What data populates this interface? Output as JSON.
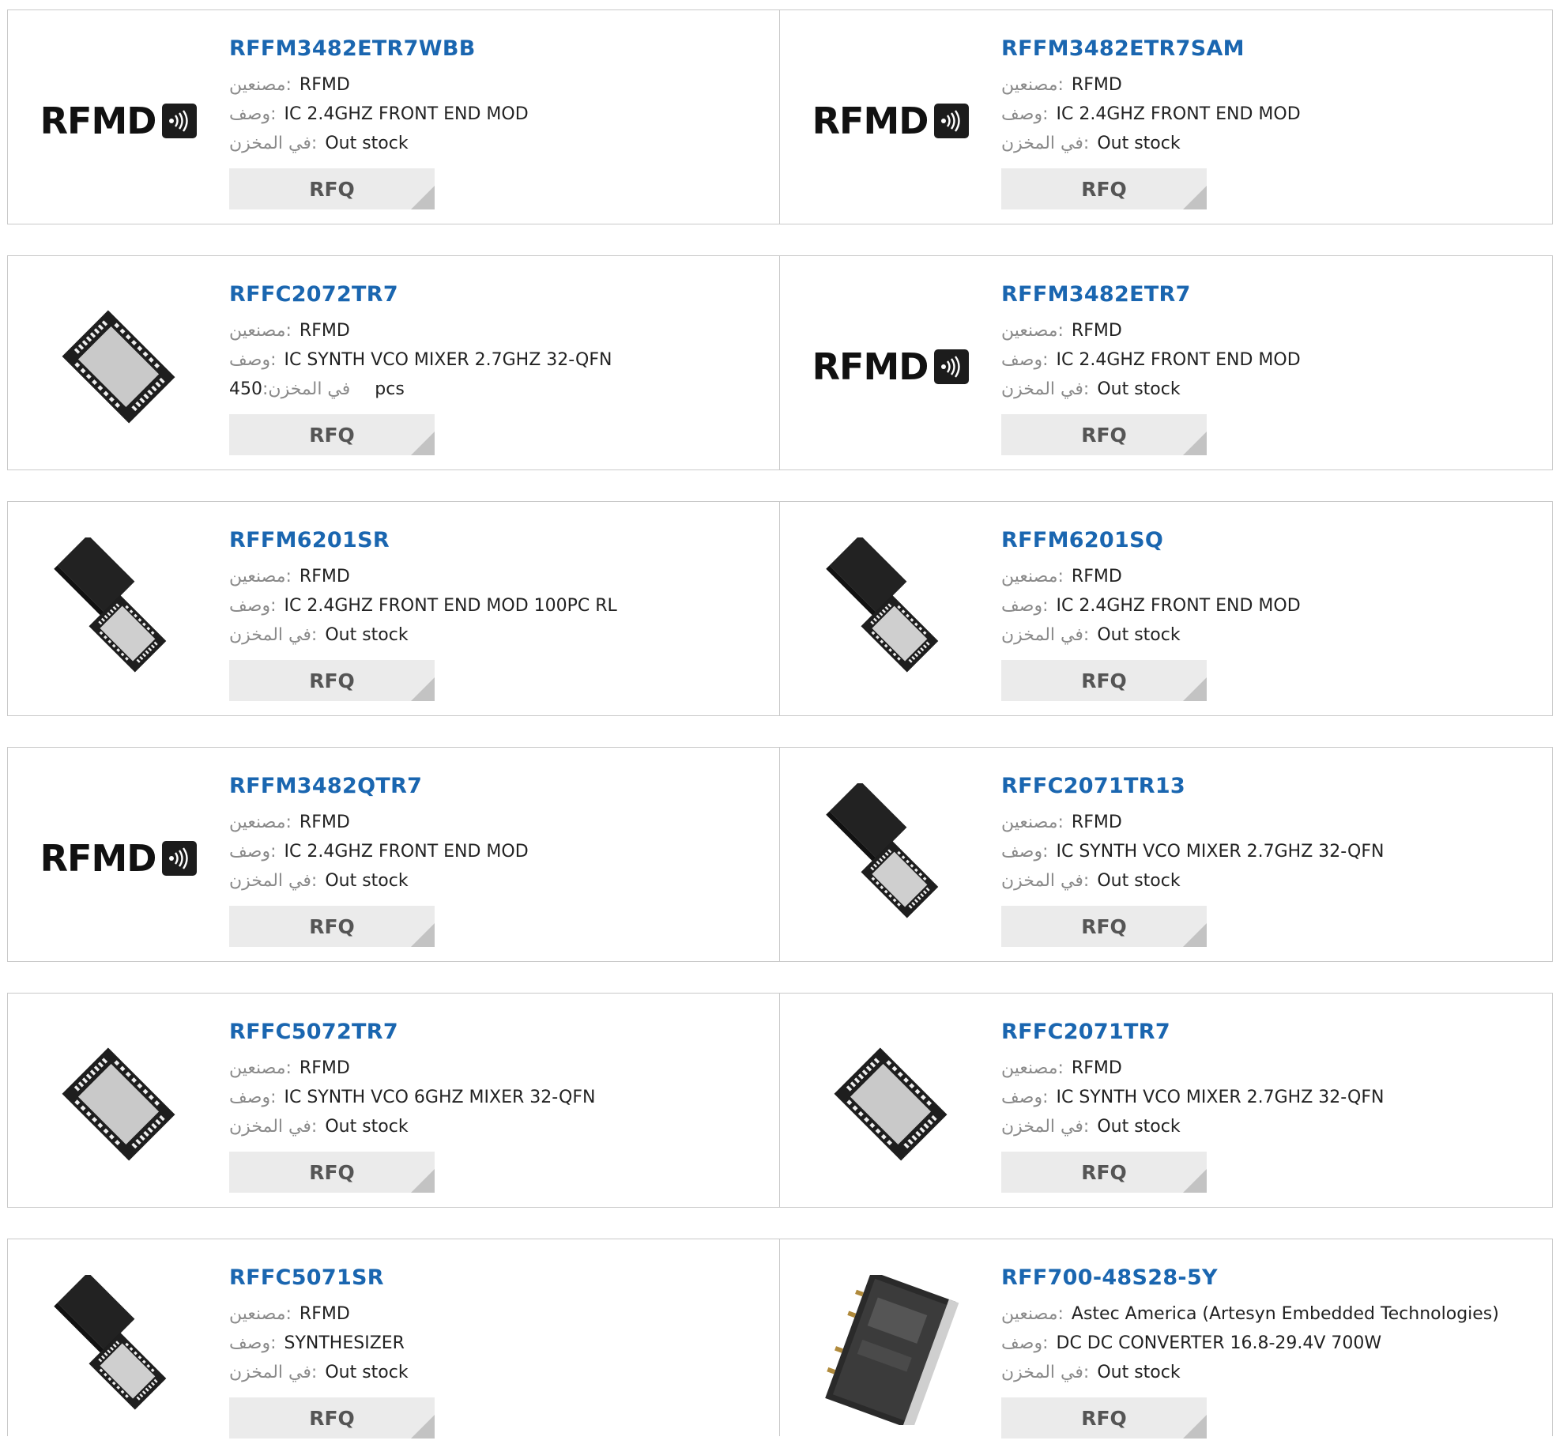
{
  "labels": {
    "manufacturer": "مصنعين:",
    "description": "وصف:",
    "in_stock": "في المخزن:",
    "rfq": "RFQ"
  },
  "colors": {
    "link": "#1a66b0",
    "button_bg": "#ebebeb",
    "border": "#c9c9c9"
  },
  "items": [
    {
      "part": "RFFM3482ETR7WBB",
      "manufacturer": "RFMD",
      "description": "IC 2.4GHZ FRONT END MOD",
      "stock": "Out stock",
      "image": "rfmd-logo",
      "logo_text": "RFMD"
    },
    {
      "part": "RFFM3482ETR7SAM",
      "manufacturer": "RFMD",
      "description": "IC 2.4GHZ FRONT END MOD",
      "stock": "Out stock",
      "image": "rfmd-logo",
      "logo_text": "RFMD"
    },
    {
      "part": "RFFC2072TR7",
      "manufacturer": "RFMD",
      "description": "IC SYNTH VCO MIXER 2.7GHZ 32-QFN",
      "stock": "450",
      "stock_unit": "pcs",
      "image": "qfn-chip-icon"
    },
    {
      "part": "RFFM3482ETR7",
      "manufacturer": "RFMD",
      "description": "IC 2.4GHZ FRONT END MOD",
      "stock": "Out stock",
      "image": "rfmd-logo",
      "logo_text": "RFMD"
    },
    {
      "part": "RFFM6201SR",
      "manufacturer": "RFMD",
      "description": "IC 2.4GHZ FRONT END MOD 100PC RL",
      "stock": "Out stock",
      "image": "qfn-pair-icon"
    },
    {
      "part": "RFFM6201SQ",
      "manufacturer": "RFMD",
      "description": "IC 2.4GHZ FRONT END MOD",
      "stock": "Out stock",
      "image": "qfn-pair-icon"
    },
    {
      "part": "RFFM3482QTR7",
      "manufacturer": "RFMD",
      "description": "IC 2.4GHZ FRONT END MOD",
      "stock": "Out stock",
      "image": "rfmd-logo",
      "logo_text": "RFMD"
    },
    {
      "part": "RFFC2071TR13",
      "manufacturer": "RFMD",
      "description": "IC SYNTH VCO MIXER 2.7GHZ 32-QFN",
      "stock": "Out stock",
      "image": "qfn-pair-icon"
    },
    {
      "part": "RFFC5072TR7",
      "manufacturer": "RFMD",
      "description": "IC SYNTH VCO 6GHZ MIXER 32-QFN",
      "stock": "Out stock",
      "image": "qfn-chip-icon"
    },
    {
      "part": "RFFC2071TR7",
      "manufacturer": "RFMD",
      "description": "IC SYNTH VCO MIXER 2.7GHZ 32-QFN",
      "stock": "Out stock",
      "image": "qfn-chip-icon"
    },
    {
      "part": "RFFC5071SR",
      "manufacturer": "RFMD",
      "description": "SYNTHESIZER",
      "stock": "Out stock",
      "image": "qfn-pair-icon"
    },
    {
      "part": "RFF700-48S28-5Y",
      "manufacturer": "Astec America (Artesyn Embedded Technologies)",
      "description": "DC DC CONVERTER 16.8-29.4V 700W",
      "stock": "Out stock",
      "image": "dc-converter-icon"
    }
  ]
}
